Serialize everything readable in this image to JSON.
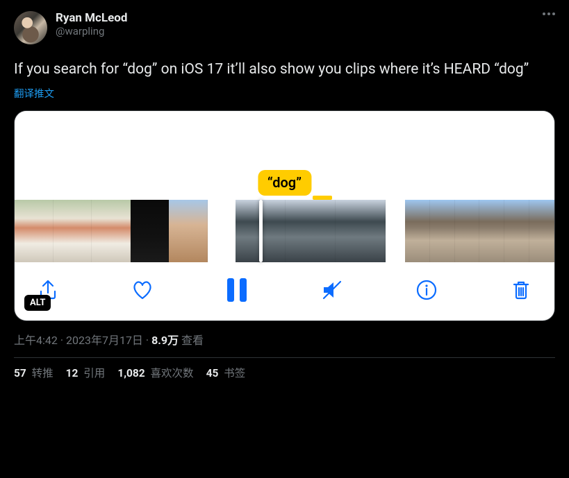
{
  "author": {
    "name": "Ryan McLeod",
    "handle": "@warpling"
  },
  "body": "If you search for “dog” on iOS 17 it’ll also show you clips where it’s HEARD “dog”",
  "translate_label": "翻译推文",
  "media": {
    "search_term_bubble": "“dog”",
    "alt_badge": "ALT",
    "icons": {
      "share": "share-icon",
      "heart": "heart-icon",
      "pause": "pause-icon",
      "mute": "mute-icon",
      "info": "info-icon",
      "trash": "trash-icon"
    }
  },
  "meta": {
    "time": "上午4:42",
    "sep1": " · ",
    "date": "2023年7月17日",
    "sep2": " · ",
    "views_count": "8.9万",
    "views_label": " 查看"
  },
  "stats": {
    "retweets": {
      "count": "57",
      "label": " 转推"
    },
    "quotes": {
      "count": "12",
      "label": " 引用"
    },
    "likes": {
      "count": "1,082",
      "label": " 喜欢次数"
    },
    "bookmarks": {
      "count": "45",
      "label": " 书签"
    }
  }
}
